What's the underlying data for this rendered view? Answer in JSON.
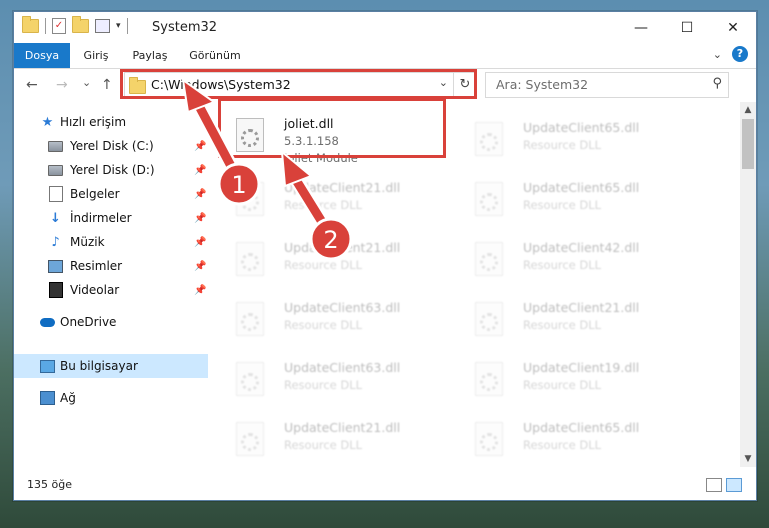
{
  "window": {
    "title": "System32",
    "controls": {
      "minimize": "—",
      "maximize": "☐",
      "close": "✕"
    }
  },
  "ribbon": {
    "tabs": [
      "Dosya",
      "Giriş",
      "Paylaş",
      "Görünüm"
    ],
    "expand_icon": "chevron-down-icon",
    "help_label": "?"
  },
  "navigation": {
    "back": "←",
    "forward": "→",
    "recent": "⌄",
    "up": "↑",
    "address": "C:\\Windows\\System32",
    "refresh": "↻",
    "search_placeholder": "Ara: System32"
  },
  "sidebar": {
    "items": [
      {
        "label": "Hızlı erişim",
        "icon": "star-icon",
        "pinned": false
      },
      {
        "label": "Yerel Disk (C:)",
        "icon": "drive-icon",
        "pinned": true
      },
      {
        "label": "Yerel Disk (D:)",
        "icon": "drive-icon",
        "pinned": true
      },
      {
        "label": "Belgeler",
        "icon": "documents-icon",
        "pinned": true
      },
      {
        "label": "İndirmeler",
        "icon": "download-icon",
        "pinned": true
      },
      {
        "label": "Müzik",
        "icon": "music-icon",
        "pinned": true
      },
      {
        "label": "Resimler",
        "icon": "pictures-icon",
        "pinned": true
      },
      {
        "label": "Videolar",
        "icon": "videos-icon",
        "pinned": true
      },
      {
        "label": "OneDrive",
        "icon": "cloud-icon",
        "pinned": false
      },
      {
        "label": "Bu bilgisayar",
        "icon": "computer-icon",
        "pinned": false,
        "selected": true
      },
      {
        "label": "Ağ",
        "icon": "network-icon",
        "pinned": false
      }
    ]
  },
  "files": {
    "main": {
      "name": "joliet.dll",
      "version": "5.3.1.158",
      "description": "Joliet Module"
    },
    "background": [
      {
        "name": "UpdateClient65.dll",
        "desc": "Resource DLL"
      },
      {
        "name": "UpdateClient21.dll",
        "desc": "Resource DLL"
      },
      {
        "name": "UpdateClient65.dll",
        "desc": "Resource DLL"
      },
      {
        "name": "UpdateClient21.dll",
        "desc": "Resource DLL"
      },
      {
        "name": "UpdateClient42.dll",
        "desc": "Resource DLL"
      },
      {
        "name": "UpdateClient63.dll",
        "desc": "Resource DLL"
      },
      {
        "name": "UpdateClient21.dll",
        "desc": "Resource DLL"
      },
      {
        "name": "UpdateClient63.dll",
        "desc": "Resource DLL"
      },
      {
        "name": "UpdateClient19.dll",
        "desc": "Resource DLL"
      },
      {
        "name": "UpdateClient21.dll",
        "desc": "Resource DLL"
      },
      {
        "name": "UpdateClient65.dll",
        "desc": "Resource DLL"
      }
    ]
  },
  "status": {
    "item_count": "135 öğe"
  },
  "annotations": {
    "step1": "1",
    "step2": "2",
    "color": "#d9413a"
  }
}
